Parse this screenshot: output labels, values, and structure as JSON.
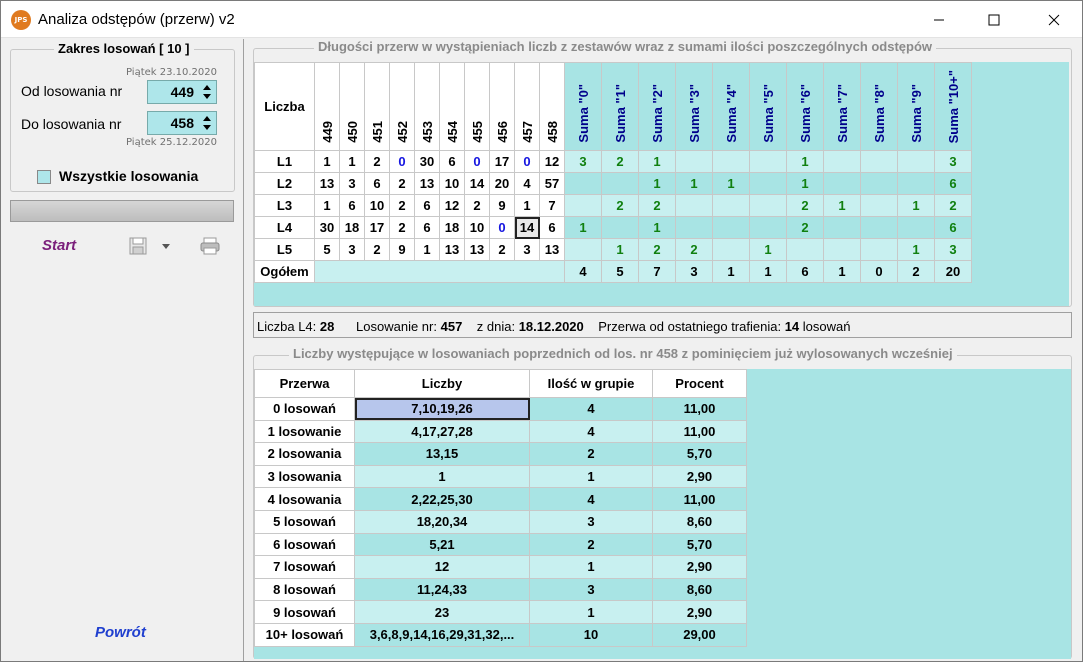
{
  "window": {
    "title": "Analiza odstępów (przerw) v2",
    "icon_text": "JPS"
  },
  "left": {
    "group_title": "Zakres losowań  [ 10 ]",
    "from_date": "Piątek 23.10.2020",
    "from_label": "Od losowania nr",
    "from_value": "449",
    "to_label": "Do losowania nr",
    "to_value": "458",
    "to_date": "Piątek 25.12.2020",
    "all_label": "Wszystkie losowania",
    "start_label": "Start",
    "back_label": "Powrót"
  },
  "top": {
    "title": "Długości przerw w wystąpieniach liczb z zestawów wraz z sumami ilości poszczególnych odstępów",
    "corner_label": "Liczba",
    "slash": "/",
    "draw_headers": [
      "449",
      "450",
      "451",
      "452",
      "453",
      "454",
      "455",
      "456",
      "457",
      "458"
    ],
    "sum_headers": [
      "Suma \"0\"",
      "Suma \"1\"",
      "Suma \"2\"",
      "Suma \"3\"",
      "Suma \"4\"",
      "Suma \"5\"",
      "Suma \"6\"",
      "Suma \"7\"",
      "Suma \"8\"",
      "Suma \"9\"",
      "Suma \"10+\""
    ],
    "rows": [
      {
        "label": "L1",
        "draws": [
          "1",
          "1",
          "2",
          "0",
          "30",
          "6",
          "0",
          "17",
          "0",
          "12"
        ],
        "sums": [
          "3",
          "2",
          "1",
          "",
          "",
          "",
          "1",
          "",
          "",
          "",
          "3"
        ]
      },
      {
        "label": "L2",
        "draws": [
          "13",
          "3",
          "6",
          "2",
          "13",
          "10",
          "14",
          "20",
          "4",
          "57"
        ],
        "sums": [
          "",
          "",
          "1",
          "1",
          "1",
          "",
          "1",
          "",
          "",
          "",
          "6"
        ]
      },
      {
        "label": "L3",
        "draws": [
          "1",
          "6",
          "10",
          "2",
          "6",
          "12",
          "2",
          "9",
          "1",
          "7"
        ],
        "sums": [
          "",
          "2",
          "2",
          "",
          "",
          "",
          "2",
          "1",
          "",
          "1",
          "2"
        ]
      },
      {
        "label": "L4",
        "draws": [
          "30",
          "18",
          "17",
          "2",
          "6",
          "18",
          "10",
          "0",
          "14",
          "6"
        ],
        "sums": [
          "1",
          "",
          "1",
          "",
          "",
          "",
          "2",
          "",
          "",
          "",
          "6"
        ]
      },
      {
        "label": "L5",
        "draws": [
          "5",
          "3",
          "2",
          "9",
          "1",
          "13",
          "13",
          "2",
          "3",
          "13"
        ],
        "sums": [
          "",
          "1",
          "2",
          "2",
          "",
          "1",
          "",
          "",
          "",
          "1",
          "3"
        ]
      }
    ],
    "total_label": "Ogółem",
    "totals": [
      "4",
      "5",
      "7",
      "3",
      "1",
      "1",
      "6",
      "1",
      "0",
      "2",
      "20"
    ]
  },
  "status": {
    "liczba_label": "Liczba L4:",
    "liczba_value": "28",
    "los_label": "Losowanie nr:",
    "los_value": "457",
    "date_label": "z dnia:",
    "date_value": "18.12.2020",
    "przerwa_label": "Przerwa od ostatniego trafienia:",
    "przerwa_value": "14",
    "przerwa_unit": "losowań"
  },
  "bottom": {
    "title": "Liczby występujące w losowaniach poprzednich od los. nr 458 z pominięciem już wylosowanych wcześniej",
    "headers": [
      "Przerwa",
      "Liczby",
      "Ilość w grupie",
      "Procent"
    ],
    "rows": [
      [
        "0 losowań",
        "7,10,19,26",
        "4",
        "11,00"
      ],
      [
        "1 losowanie",
        "4,17,27,28",
        "4",
        "11,00"
      ],
      [
        "2 losowania",
        "13,15",
        "2",
        "5,70"
      ],
      [
        "3 losowania",
        "1",
        "1",
        "2,90"
      ],
      [
        "4 losowania",
        "2,22,25,30",
        "4",
        "11,00"
      ],
      [
        "5 losowań",
        "18,20,34",
        "3",
        "8,60"
      ],
      [
        "6 losowań",
        "5,21",
        "2",
        "5,70"
      ],
      [
        "7 losowań",
        "12",
        "1",
        "2,90"
      ],
      [
        "8 losowań",
        "11,24,33",
        "3",
        "8,60"
      ],
      [
        "9 losowań",
        "23",
        "1",
        "2,90"
      ],
      [
        "10+ losowań",
        "3,6,8,9,14,16,29,31,32,...",
        "10",
        "29,00"
      ]
    ]
  },
  "colors": {
    "cyan": "#a8e4e4",
    "cyan_light": "#c8f0f0",
    "green": "#108010",
    "blue": "#1515e0",
    "header_blue": "#00008b"
  }
}
